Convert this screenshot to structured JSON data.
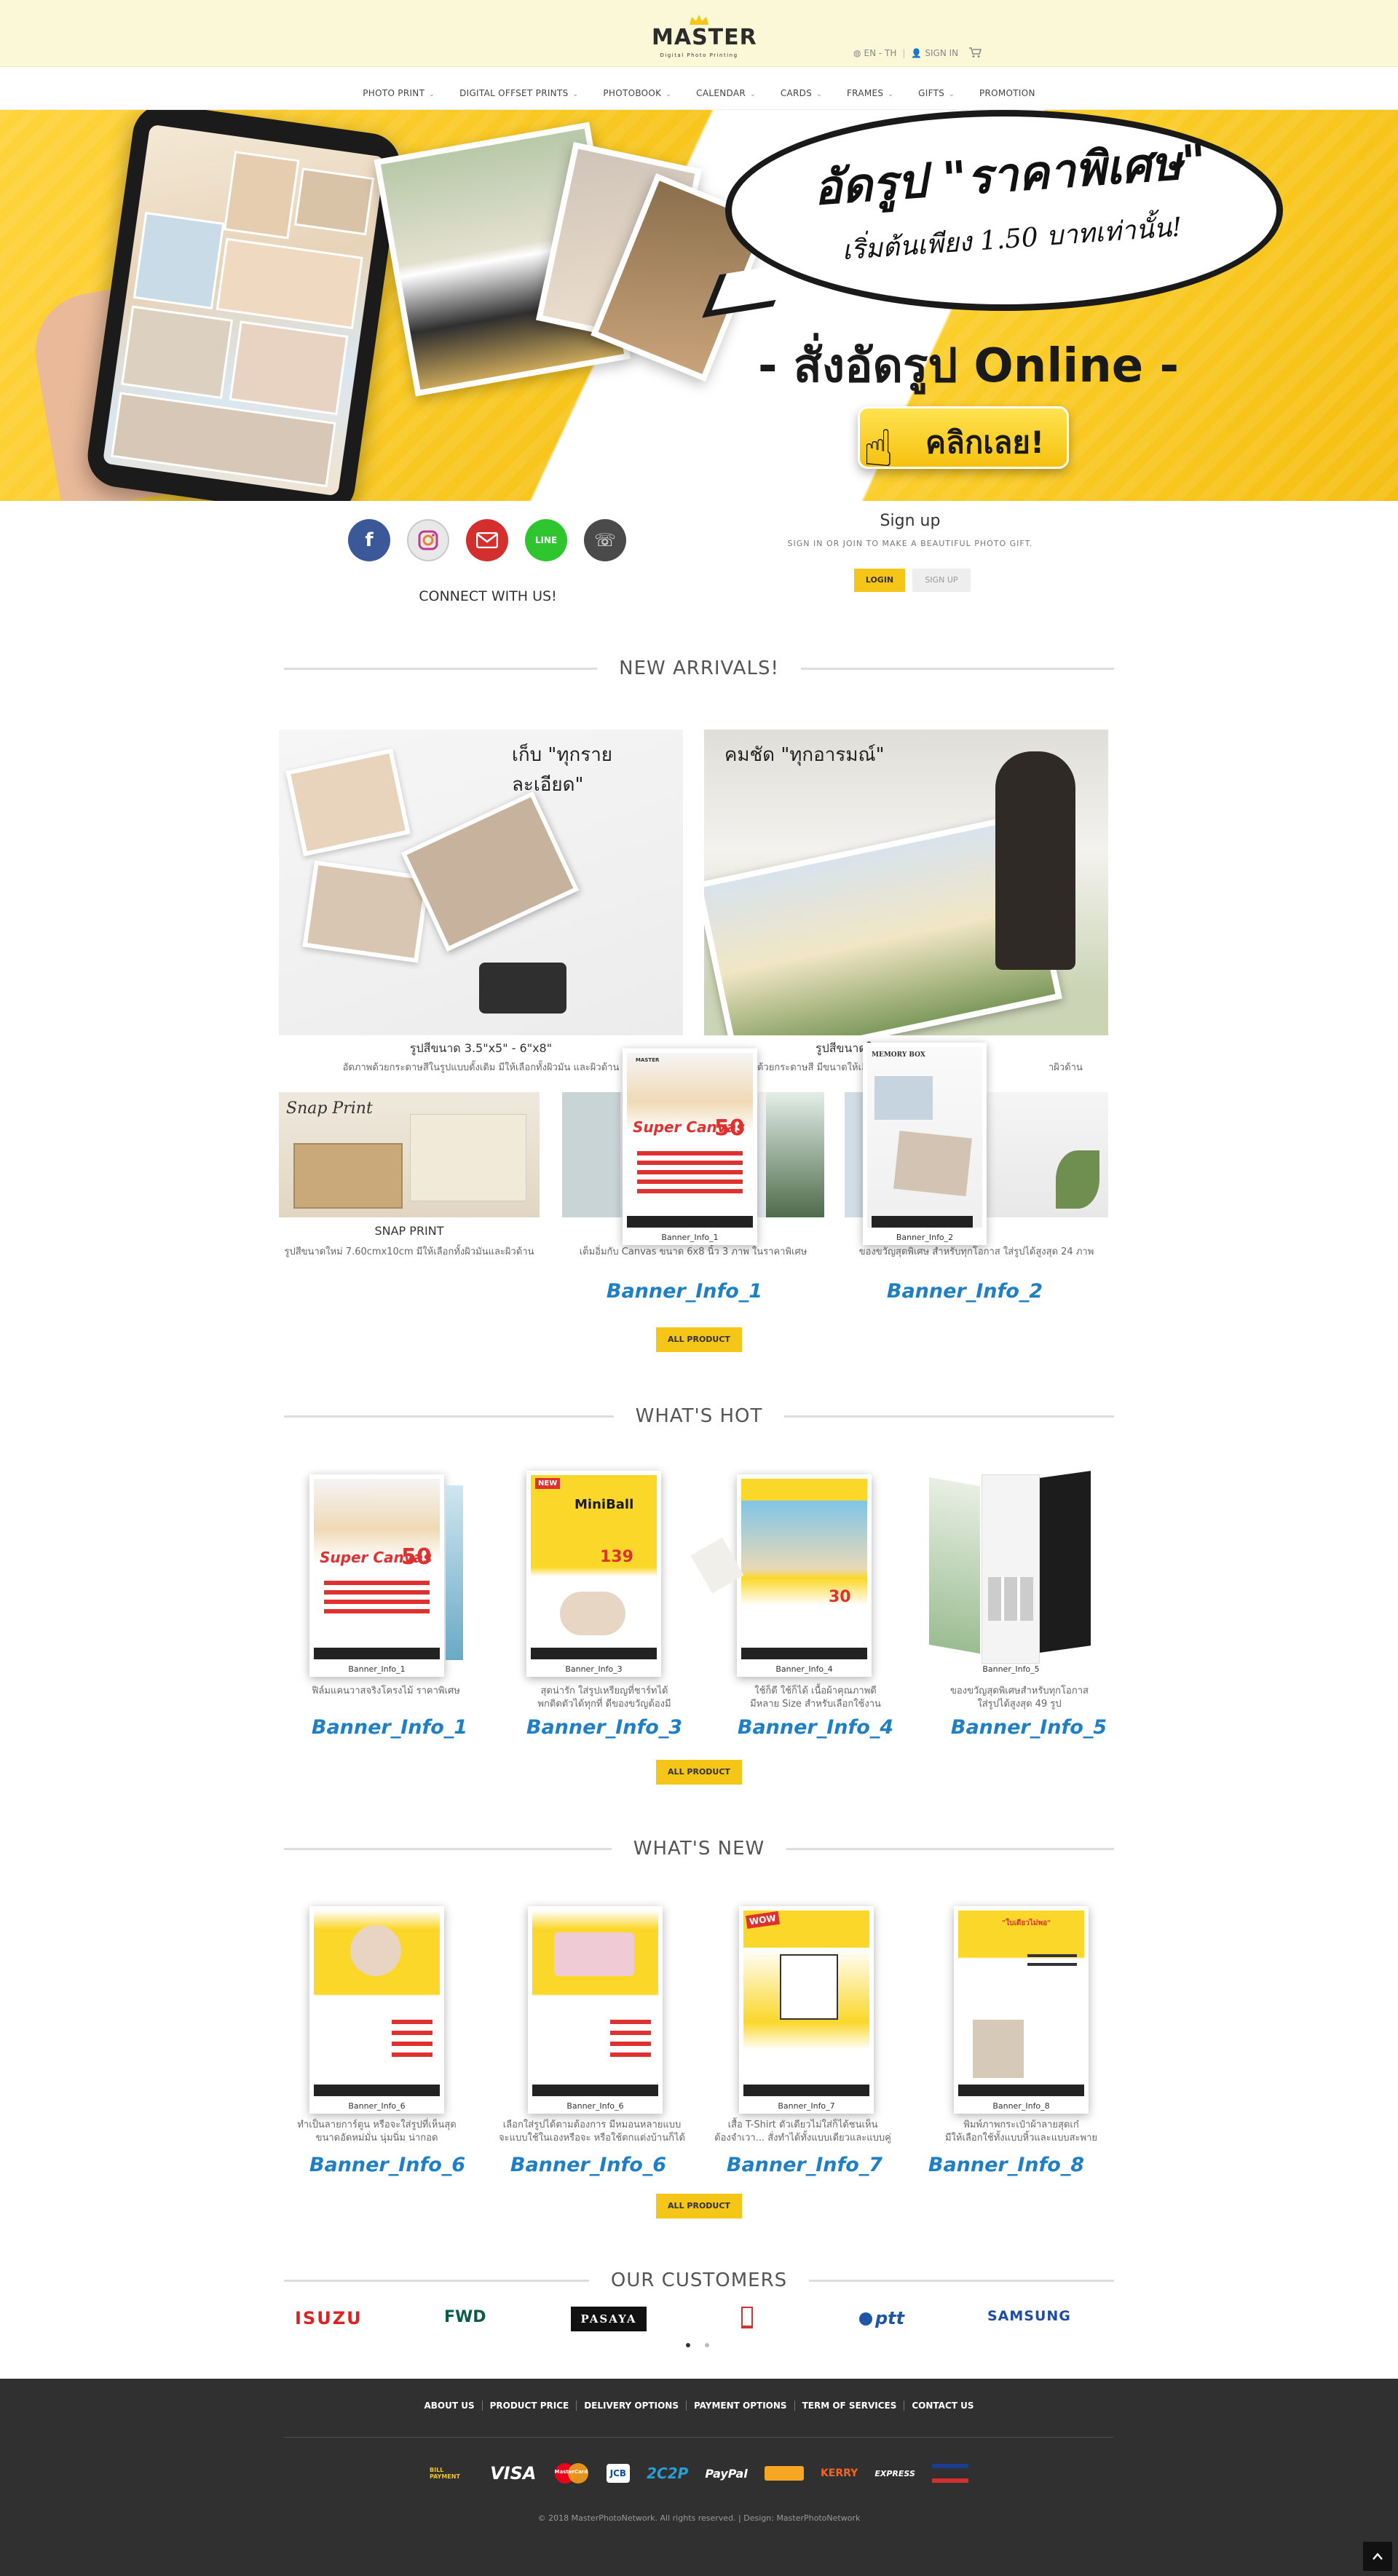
{
  "header": {
    "logo_name": "MASTER",
    "logo_tagline": "Digital Photo Printing",
    "lang": "EN - TH",
    "signin": "SIGN IN"
  },
  "nav": [
    {
      "label": "PHOTO PRINT",
      "dropdown": true
    },
    {
      "label": "DIGITAL OFFSET PRINTS",
      "dropdown": true
    },
    {
      "label": "PHOTOBOOK",
      "dropdown": true
    },
    {
      "label": "CALENDAR",
      "dropdown": true
    },
    {
      "label": "CARDS",
      "dropdown": true
    },
    {
      "label": "FRAMES",
      "dropdown": true
    },
    {
      "label": "GIFTS",
      "dropdown": true
    },
    {
      "label": "PROMOTION",
      "dropdown": false
    }
  ],
  "hero": {
    "line1": "อัดรูป \"ราคาพิเศษ\"",
    "line2": "เริ่มต้นเพียง 1.50 บาทเท่านั้น!",
    "line3": "- สั่งอัดรูป Online -",
    "cta": "คลิกเลย!"
  },
  "social": {
    "connect": "CONNECT WITH US!",
    "icons": [
      "facebook-icon",
      "instagram-icon",
      "email-icon",
      "line-icon",
      "phone-icon"
    ]
  },
  "signup": {
    "title": "Sign up",
    "subtitle": "SIGN IN OR JOIN TO MAKE A BEAUTIFUL PHOTO GIFT.",
    "login": "LOGIN",
    "signup": "SIGN UP"
  },
  "arrivals": {
    "title": "NEW ARRIVALS!",
    "banner1_text": "เก็บ \"ทุกรายละเอียด\"",
    "banner2_text": "คมชัด \"ทุกอารมณ์\"",
    "caption1": "รูปสีขนาด 3.5\"x5\" - 6\"x8\"",
    "desc1": "อัดภาพด้วยกระดาษสีในรูปแบบดั้งเดิม มีให้เลือกทั้งผิวมัน และผิวด้าน",
    "caption2": "รูปสีขนาดให",
    "desc2": "ด้วยกระดาษสี มีขนาดให้เลือกทั้ง",
    "desc2b": "าผิวด้าน",
    "snap_caption": "SNAP PRINT",
    "snap_desc": "รูปสีขนาดใหม่ 7.60cmx10cm มีให้เลือกทั้งผิวมันและผิวด้าน",
    "canvas_desc": "เต็มอิ่มกับ Canvas ขนาด 6x8 นิ้ว 3 ภาพ ในราคาพิเศษ",
    "memory_desc": "ของขวัญสุดพิเศษ สำหรับทุกโอกาส ใส่รูปได้สูงสุด 24 ภาพ",
    "popup1_label": "Banner_Info_1",
    "popup2_label": "Banner_Info_2",
    "info1": "Banner_Info_1",
    "info2": "Banner_Info_2",
    "all": "ALL PRODUCT"
  },
  "hot": {
    "title": "WHAT'S HOT",
    "items": [
      {
        "label": "Banner_Info_1",
        "desc": "ฟิล์มแคนวาสจริงโครงไม้ ราคาพิเศษ",
        "desc2": "",
        "info": "Banner_Info_1"
      },
      {
        "label": "Banner_Info_3",
        "desc": "สุดน่ารัก ใส่รูปเหรียญที่ชาร์ทได้",
        "desc2": "พกติดตัวได้ทุกที่ ดีของขวัญต้องมี",
        "info": "Banner_Info_3"
      },
      {
        "label": "Banner_Info_4",
        "desc": "ใช้ก็ดี ใช้ก็ได้ เนื้อผ้าคุณภาพดี",
        "desc2": "มีหลาย Size สำหรับเลือกใช้งาน",
        "info": "Banner_Info_4"
      },
      {
        "label": "Banner_Info_5",
        "desc": "ของขวัญสุดพิเศษสำหรับทุกโอกาส",
        "desc2": "ใส่รูปได้สูงสุด 49 รูป",
        "info": "Banner_Info_5"
      }
    ],
    "all": "ALL PRODUCT"
  },
  "new": {
    "title": "WHAT'S NEW",
    "items": [
      {
        "label": "Banner_Info_6",
        "desc": "ทำเป็นลายการ์ตูน หรือจะใส่รูปที่เห็นสุด",
        "desc2": "ขนาดอัดหม่มั่น นุ่มนิ่ม น่ากอด",
        "info": "Banner_Info_6"
      },
      {
        "label": "Banner_Info_6",
        "desc": "เลือกใส่รูปได้ตามต้องการ มีหมอนหลายแบบ",
        "desc2": "จะแบบใช้ในเองหรือจะ หรือใช้ตกแต่งบ้านก็ได้",
        "info": "Banner_Info_6"
      },
      {
        "label": "Banner_Info_7",
        "desc": "เสื้อ T-Shirt ตัวเดียวไม่ใส่ก็ได้ชนเห็น",
        "desc2": "ต้องจำเวา... สั่งทำได้ทั้งแบบเดียวและแบบคู่",
        "info": "Banner_Info_7"
      },
      {
        "label": "Banner_Info_8",
        "desc": "พิมพ์ภาพกระเป๋าผ้าลายสุดเก๋",
        "desc2": "มีให้เลือกใช้ทั้งแบบหิ้วและแบบสะพาย",
        "info": "Banner_Info_8"
      }
    ],
    "all": "ALL PRODUCT"
  },
  "customers": {
    "title": "OUR CUSTOMERS",
    "logos": [
      "ISUZU",
      "FWD",
      "PASAYA",
      "",
      "ptt",
      "SAMSUNG"
    ]
  },
  "footer": {
    "links": [
      "ABOUT US",
      "PRODUCT PRICE",
      "DELIVERY OPTIONS",
      "PAYMENT OPTIONS",
      "TERM OF SERVICES",
      "CONTACT US"
    ],
    "payments": [
      "BILL PAYMENT",
      "VISA",
      "MasterCard",
      "JCB",
      "2C2P",
      "PayPal",
      "",
      "KERRY",
      "EXPRESS",
      ""
    ],
    "copyright": "© 2018 MasterPhotoNetwork. All rights reserved. | Design: MasterPhotoNetwork"
  },
  "colors": {
    "accent": "#f5c518",
    "info_blue": "#1f7fc4",
    "footer_bg": "#303030",
    "header_bg": "#fbf8d7"
  }
}
